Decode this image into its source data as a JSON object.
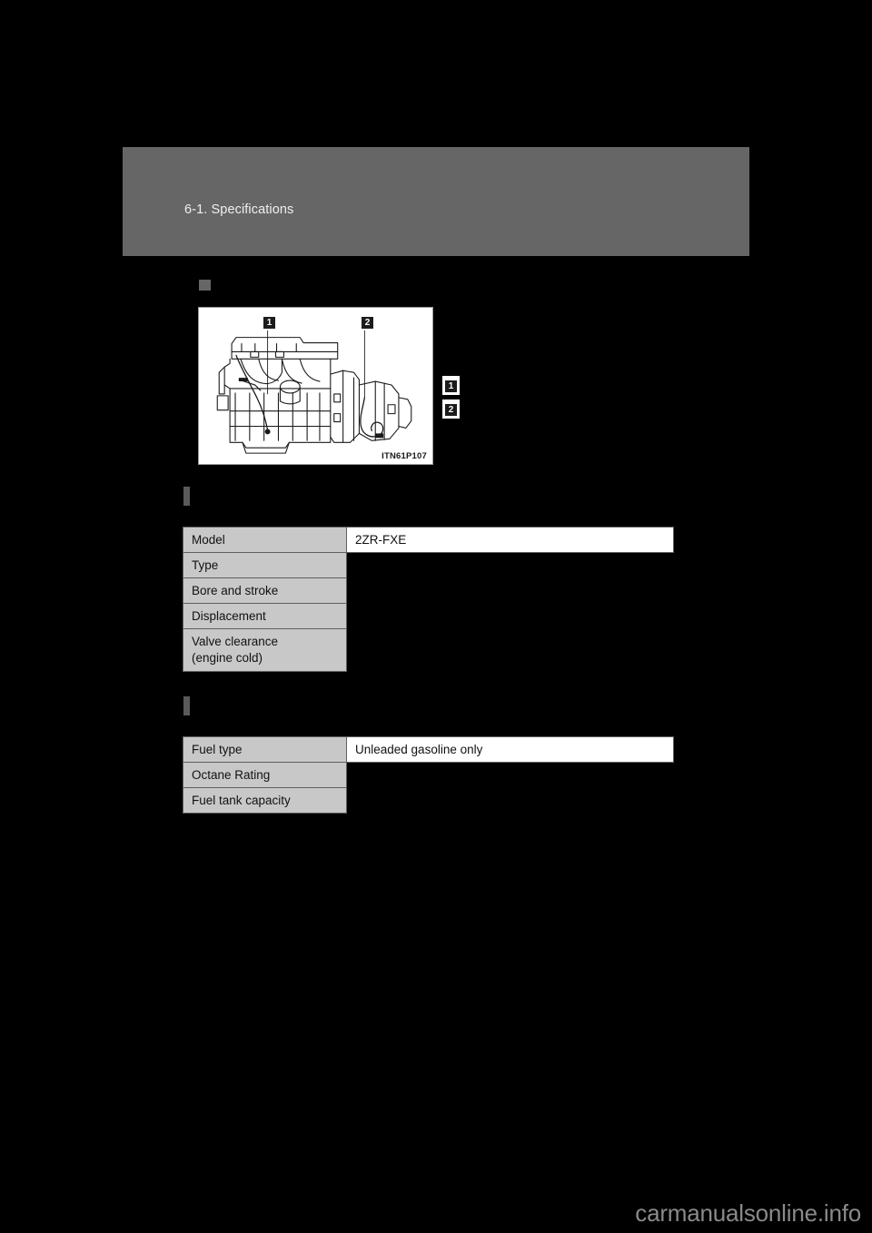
{
  "page": {
    "background_color": "#000000",
    "watermark": "carmanualsonline.info"
  },
  "header": {
    "title": "6-1. Specifications",
    "background_color": "#666666",
    "text_color": "#efefef"
  },
  "figure": {
    "code": "ITN61P107",
    "alt": "engine-line-drawing",
    "callouts": [
      {
        "number": "1"
      },
      {
        "number": "2"
      }
    ]
  },
  "legend": {
    "items": [
      {
        "number": "1",
        "label": ""
      },
      {
        "number": "2",
        "label": ""
      }
    ]
  },
  "engine_section": {
    "heading": "",
    "rows": [
      {
        "label": "Model",
        "label_line2": "",
        "value": "2ZR-FXE",
        "value_visible": true
      },
      {
        "label": "Type",
        "label_line2": "",
        "value": "",
        "value_visible": false
      },
      {
        "label": "Bore and stroke",
        "label_line2": "",
        "value": "",
        "value_visible": false
      },
      {
        "label": "Displacement",
        "label_line2": "",
        "value": "",
        "value_visible": false
      },
      {
        "label": "Valve clearance",
        "label_line2": "(engine cold)",
        "value": "",
        "value_visible": false
      }
    ]
  },
  "fuel_section": {
    "heading": "",
    "rows": [
      {
        "label": "Fuel type",
        "label_line2": "",
        "value": "Unleaded gasoline only",
        "value_visible": true
      },
      {
        "label": "Octane Rating",
        "label_line2": "",
        "value": "",
        "value_visible": false
      },
      {
        "label": "Fuel tank capacity",
        "label_line2": "",
        "value": "",
        "value_visible": false
      }
    ]
  },
  "colors": {
    "header_gray": "#666666",
    "label_cell_gray": "#c8c8c8",
    "marker_gray": "#5a5a5a",
    "badge_black": "#1c1c1c",
    "watermark_gray": "#8a8a8a"
  }
}
